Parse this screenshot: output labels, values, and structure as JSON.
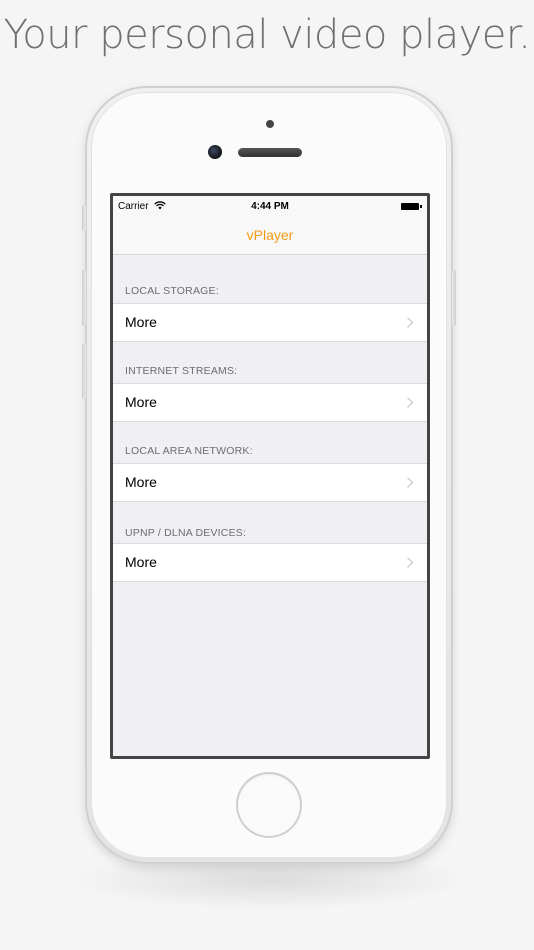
{
  "promo": {
    "headline": "Your personal video player."
  },
  "status_bar": {
    "carrier": "Carrier",
    "time": "4:44 PM",
    "wifi_icon": "wifi-icon",
    "battery_icon": "battery-icon"
  },
  "nav": {
    "title": "vPlayer",
    "title_color": "#f39c12"
  },
  "sections": [
    {
      "header": "LOCAL STORAGE:",
      "cell_label": "More",
      "accessory": "chevron-right-icon"
    },
    {
      "header": "INTERNET STREAMS:",
      "cell_label": "More",
      "accessory": "chevron-right-icon"
    },
    {
      "header": "LOCAL AREA NETWORK:",
      "cell_label": "More",
      "accessory": "chevron-right-icon"
    },
    {
      "header": "UPNP / DLNA DEVICES:",
      "cell_label": "More",
      "accessory": "chevron-right-icon"
    }
  ]
}
